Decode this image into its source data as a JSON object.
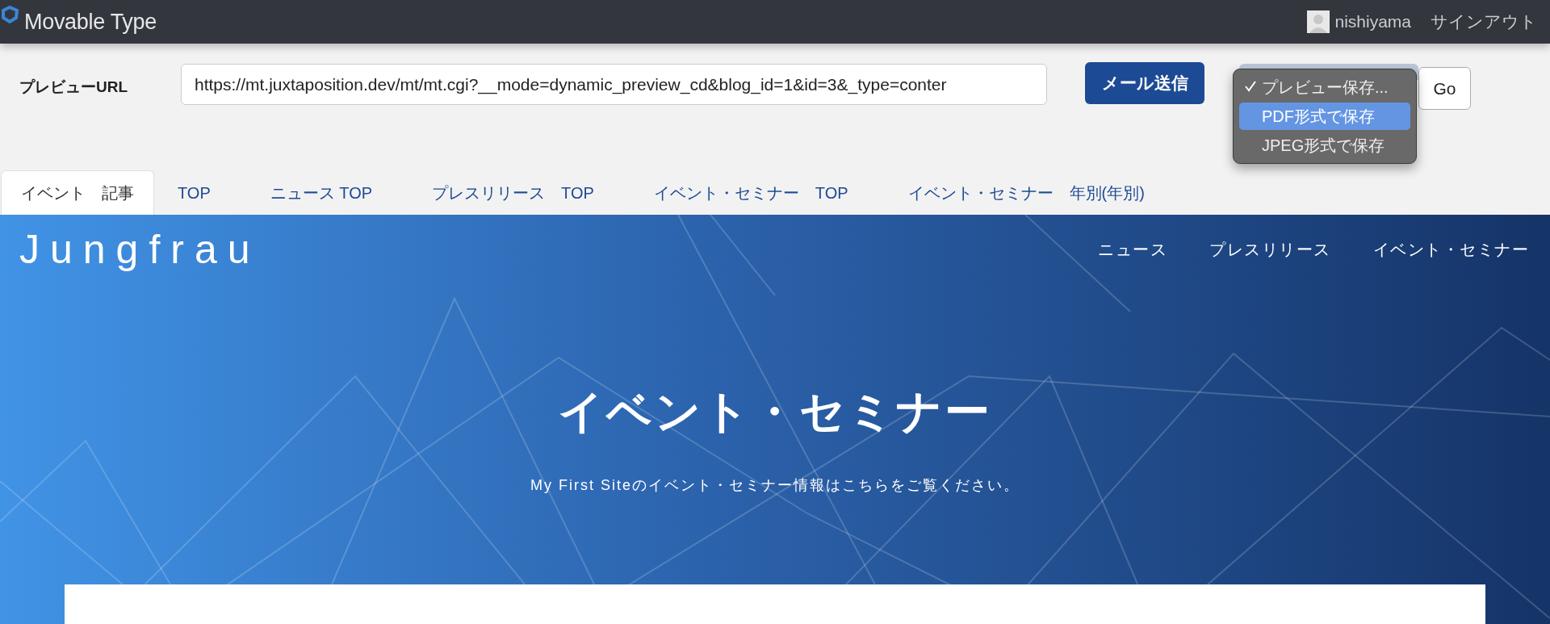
{
  "header": {
    "logo": "Movable Type",
    "user": "nishiyama",
    "signout": "サインアウト"
  },
  "preview": {
    "label": "プレビューURL",
    "url": "https://mt.juxtaposition.dev/mt/mt.cgi?__mode=dynamic_preview_cd&blog_id=1&id=3&_type=conter",
    "send_button": "メール送信",
    "go_button": "Go",
    "save_menu": [
      {
        "label": "プレビュー保存...",
        "checked": true,
        "highlighted": false
      },
      {
        "label": "PDF形式で保存",
        "checked": false,
        "highlighted": true
      },
      {
        "label": "JPEG形式で保存",
        "checked": false,
        "highlighted": false
      }
    ]
  },
  "tabs": [
    {
      "label": "イベント　記事",
      "selected": true
    },
    {
      "label": "TOP",
      "selected": false
    },
    {
      "label": "ニュース TOP",
      "selected": false
    },
    {
      "label": "プレスリリース　TOP",
      "selected": false
    },
    {
      "label": "イベント・セミナー　TOP",
      "selected": false
    },
    {
      "label": "イベント・セミナー　年別(年別)",
      "selected": false
    }
  ],
  "site": {
    "title": "Jungfrau",
    "nav": [
      "ニュース",
      "プレスリリース",
      "イベント・セミナー"
    ],
    "heading": "イベント・セミナー",
    "description": "My First Siteのイベント・セミナー情報はこちらをご覧ください。"
  }
}
